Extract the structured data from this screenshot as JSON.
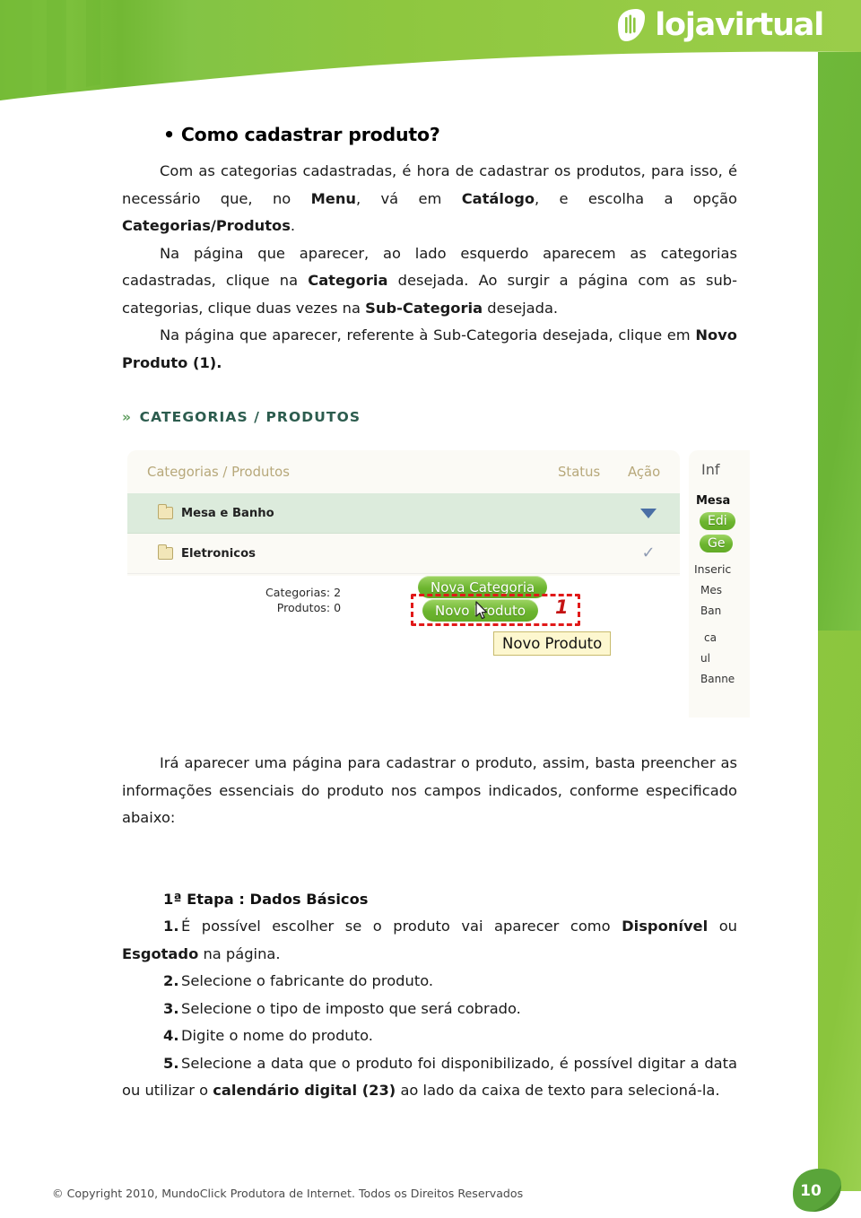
{
  "brand": {
    "logo_text": "lojavirtual",
    "green_dark": "#6cb52f",
    "green_light": "#8cc63f",
    "accent_red": "#e11919"
  },
  "doc": {
    "title": "• Como cadastrar produto?",
    "para1_a": "Com as categorias cadastradas, é hora de cadastrar os produtos, para isso, é necessário que, no ",
    "para1_b": "Menu",
    "para1_c": ", vá em ",
    "para1_d": "Catálogo",
    "para1_e": ", e escolha a opção ",
    "para1_f": "Categorias/Produtos",
    "para1_g": ".",
    "para2_a": "Na página que aparecer, ao lado esquerdo aparecem as categorias cadastradas, clique na ",
    "para2_b": "Categoria",
    "para2_c": " desejada. Ao surgir a página com as sub-categorias, clique duas vezes na ",
    "para2_d": "Sub-Categoria",
    "para2_e": " desejada.",
    "para3_a": "Na página que aparecer, referente à Sub-Categoria desejada, clique em ",
    "para3_b": "Novo Produto (1).",
    "para4": "Irá aparecer uma página para cadastrar o produto, assim, basta preencher as informações essenciais do produto nos campos indicados, conforme especificado abaixo:",
    "step_heading": "1ª Etapa :  Dados Básicos"
  },
  "steps": [
    {
      "num": "1.",
      "text_a": "É possível escolher se o produto vai aparecer como ",
      "bold_a": "Disponível",
      "text_b": " ou ",
      "bold_b": "Esgotado",
      "text_c": " na página."
    },
    {
      "num": "2.",
      "text_a": "Selecione o fabricante do produto.",
      "bold_a": "",
      "text_b": "",
      "bold_b": "",
      "text_c": ""
    },
    {
      "num": "3.",
      "text_a": "Selecione o tipo de imposto que será cobrado.",
      "bold_a": "",
      "text_b": "",
      "bold_b": "",
      "text_c": ""
    },
    {
      "num": "4.",
      "text_a": "Digite o nome do produto.",
      "bold_a": "",
      "text_b": "",
      "bold_b": "",
      "text_c": ""
    },
    {
      "num": "5.",
      "text_a": "Selecione a data que o produto foi disponibilizado, é possível digitar a data ou utilizar o ",
      "bold_a": "calendário digital (23)",
      "text_b": " ao lado da caixa de texto para selecioná-la.",
      "bold_b": "",
      "text_c": ""
    }
  ],
  "screenshot": {
    "breadcrumb_chevron": "»",
    "breadcrumb": "CATEGORIAS / PRODUTOS",
    "table": {
      "headers": [
        "Categorias / Produtos",
        "Status",
        "Ação"
      ],
      "rows": [
        {
          "name": "Mesa e Banho",
          "status": "",
          "action_icon": "triangle-down-icon",
          "highlighted": true
        },
        {
          "name": "Eletronicos",
          "status": "",
          "action_icon": "checkmark-icon",
          "highlighted": false
        }
      ]
    },
    "counts": {
      "categorias": "Categorias: 2",
      "produtos": "Produtos: 0"
    },
    "buttons": {
      "nova_categoria": "Nova Categoria",
      "novo_produto": "Novo Produto"
    },
    "callout_number": "1",
    "tooltip": "Novo Produto",
    "side_panel": {
      "title": "Inf",
      "bold": "Mesa",
      "btn1": "Edi",
      "btn2": "Ge",
      "txt1": "Inseric",
      "txt2a": "Mes",
      "txt2b": "Ban",
      "txt3a": "ca",
      "txt3b": "ul",
      "txt3c": "Banne"
    }
  },
  "footer": {
    "copyright": "© Copyright 2010, MundoClick Produtora de Internet. Todos os Direitos Reservados",
    "page_number": "10"
  }
}
